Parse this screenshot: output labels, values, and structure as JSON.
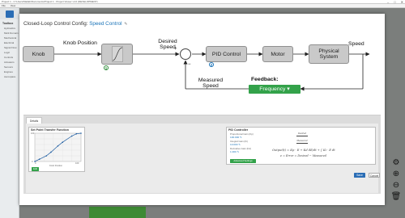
{
  "window": {
    "title": "Project 1 - C:\\Users\\Matlab\\Documents\\Project 1 - Project Viewer v4.0 (DEVELOPMENT)",
    "menu": [
      "File",
      "View"
    ],
    "controls": {
      "minimize": "–",
      "maximize": "□",
      "close": "✕"
    }
  },
  "sidebar": {
    "heading": "Toolbox",
    "items": [
      "Hydraulics",
      "Multi Domain",
      "Mechanical",
      "Electrical",
      "Signal Flow",
      "Logic",
      "Controls",
      "Actuators",
      "Sensors",
      "Engines",
      "Aerospace"
    ]
  },
  "dialog": {
    "title_prefix": "Closed-Loop Control Config:",
    "title_link": "Speed Control",
    "diagram": {
      "blocks": {
        "knob": "Knob",
        "pid": "PID Control",
        "motor": "Motor",
        "physical": "Physical System"
      },
      "labels": {
        "knob_position": "Knob Position",
        "desired_speed": "Desired Speed",
        "speed_out": "Speed",
        "measured_speed": "Measured Speed",
        "plus": "+",
        "minus": "−"
      },
      "badges": {
        "transfer": "1",
        "pid": "2"
      },
      "feedback": {
        "title": "Feedback:",
        "selected": "Frequency",
        "caret": "▾"
      }
    },
    "tab": "Details",
    "set_point_card": {
      "title": "Set Point Transfer Function",
      "y_min": "0",
      "y_max": "100",
      "x_min": "0",
      "x_max": "100",
      "x_label": "Knob Position",
      "edit_button": "Edit",
      "chart_data": {
        "type": "line",
        "x": [
          0,
          10,
          25,
          35,
          50,
          60,
          80,
          90,
          100
        ],
        "series": [
          {
            "values": [
              0,
              8,
              20,
              33,
              55,
              68,
              90,
              98,
              100
            ]
          }
        ],
        "xlim": [
          0,
          100
        ],
        "ylim": [
          0,
          100
        ],
        "xlabel": "Knob Position",
        "grid": true
      }
    },
    "pid_card": {
      "title": "PID Controller",
      "gains": [
        {
          "label": "Proportional Gain (Kp)",
          "value": "100.000"
        },
        {
          "label": "Integral Gain (Ki)",
          "value": "10.000"
        },
        {
          "label": "Derivative Gain (Kd)",
          "value": "1.000"
        }
      ],
      "pencil": "✎",
      "advanced_button": "Advanced Settings",
      "equations": {
        "eq_p": "Output(t) = Kp · E + Kd dE/dt + ∫ Ki · E dt",
        "eq_e": "e = Error = Desired − Measured",
        "frac1": "Desired",
        "frac2": "Measured"
      }
    },
    "buttons": {
      "save": "Save",
      "cancel": "Cancel"
    }
  },
  "tools": [
    "⚙",
    "⊕",
    "⊖",
    "🗑"
  ]
}
